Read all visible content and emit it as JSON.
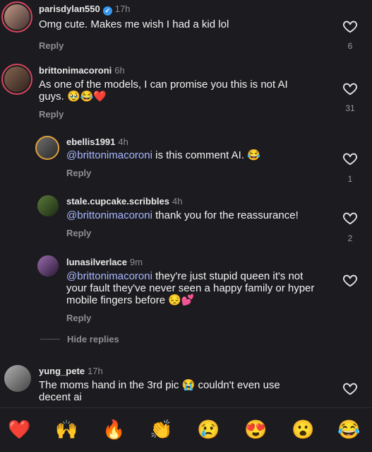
{
  "comments": [
    {
      "username": "parisdylan550",
      "time": "17h",
      "text": "Omg cute. Makes me wish I had a kid lol",
      "reply": "Reply",
      "likes": "6"
    },
    {
      "username": "brittonimacoroni",
      "time": "6h",
      "text_line1": "As one of the models, I can promise you this is not AI",
      "text_line2": "guys.",
      "emojis": "🥹😂❤️",
      "reply": "Reply",
      "likes": "31"
    },
    {
      "username": "ebellis1991",
      "time": "4h",
      "mention": "@brittonimacoroni",
      "text": "is this comment AI.",
      "emoji": "😂",
      "reply": "Reply",
      "likes": "1"
    },
    {
      "username": "stale.cupcake.scribbles",
      "time": "4h",
      "mention": "@brittonimacoroni",
      "text": "thank you for the reassurance!",
      "reply": "Reply",
      "likes": "2"
    },
    {
      "username": "lunasilverlace",
      "time": "9m",
      "mention": "@brittonimacoroni",
      "text_line1": "they're just stupid queen it's not",
      "text_line2": "your fault they've never seen a happy family or hyper",
      "text_line3": "mobile fingers before",
      "emojis": "😔💕",
      "reply": "Reply"
    },
    {
      "username": "yung_pete",
      "time": "17h",
      "text_line1a": "The moms hand in the 3rd pic",
      "emoji": "😭",
      "text_line1b": "couldn't even use",
      "text_line2": "decent ai"
    }
  ],
  "hide_replies": "Hide replies",
  "quick_emojis": [
    "❤️",
    "🙌",
    "🔥",
    "👏",
    "😢",
    "😍",
    "😮",
    "😂"
  ],
  "colors": {
    "background": "#1c1c20",
    "mention": "#a8b7ff",
    "verified": "#3797f0"
  }
}
